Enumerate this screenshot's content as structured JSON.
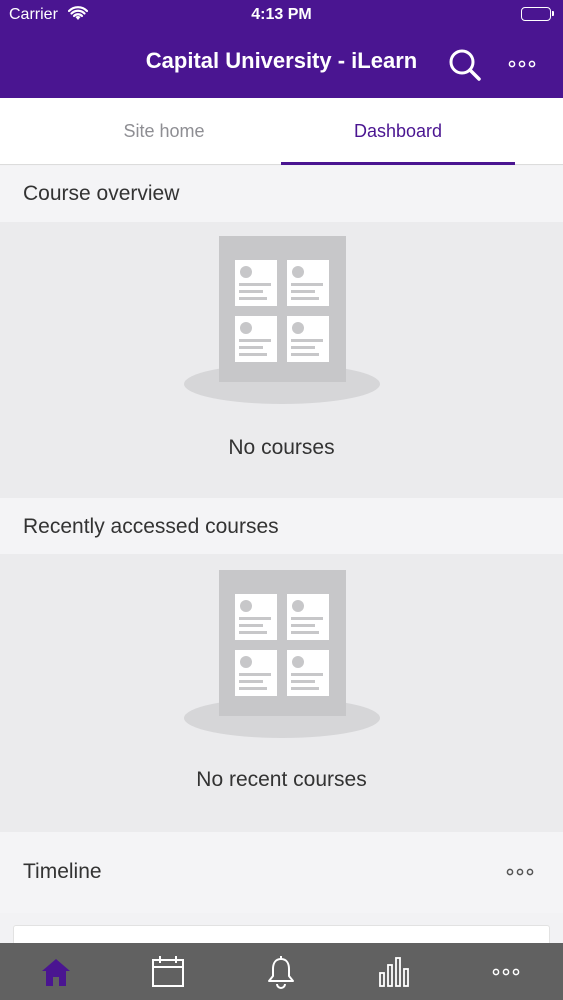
{
  "status_bar": {
    "carrier": "Carrier",
    "time": "4:13 PM"
  },
  "header": {
    "title": "Capital University - iLearn"
  },
  "tabs": [
    {
      "label": "Site home"
    },
    {
      "label": "Dashboard"
    }
  ],
  "sections": {
    "course_overview": {
      "title": "Course overview",
      "empty": "No courses"
    },
    "recent": {
      "title": "Recently accessed courses",
      "empty": "No recent courses"
    },
    "timeline": {
      "title": "Timeline"
    }
  },
  "colors": {
    "brand": "#4a1591",
    "tabbar": "#616161",
    "active_tab_icon": "#4a1591",
    "inactive_icon": "#ffffff"
  },
  "tabbar": [
    {
      "icon": "home-icon"
    },
    {
      "icon": "calendar-icon"
    },
    {
      "icon": "bell-icon"
    },
    {
      "icon": "chart-icon"
    },
    {
      "icon": "more-icon"
    }
  ]
}
